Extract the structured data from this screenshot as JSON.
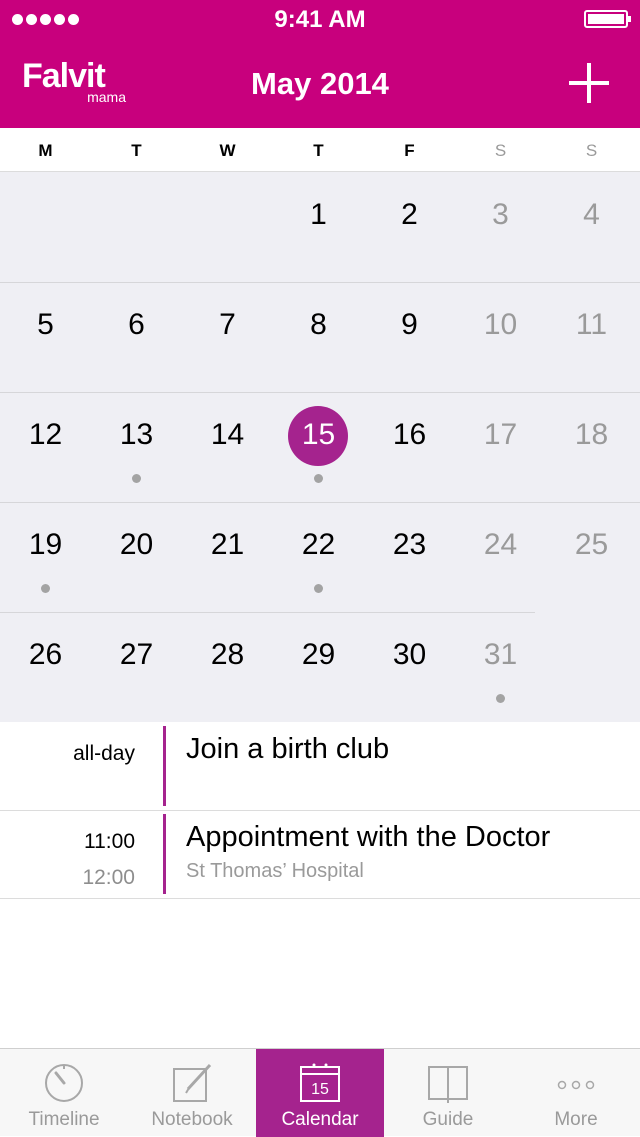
{
  "status_bar": {
    "time": "9:41 AM"
  },
  "header": {
    "logo_main": "Falvit",
    "logo_sub": "mama",
    "title": "May 2014",
    "accent": "#c8007d"
  },
  "weekdays": [
    "M",
    "T",
    "W",
    "T",
    "F",
    "S",
    "S"
  ],
  "calendar": {
    "selected_day": "15",
    "selected_color": "#a5238e",
    "weeks": [
      [
        {
          "day": "",
          "weekend": false,
          "dot": false
        },
        {
          "day": "",
          "weekend": false,
          "dot": false
        },
        {
          "day": "",
          "weekend": false,
          "dot": false
        },
        {
          "day": "1",
          "weekend": false,
          "dot": false
        },
        {
          "day": "2",
          "weekend": false,
          "dot": false
        },
        {
          "day": "3",
          "weekend": true,
          "dot": false
        },
        {
          "day": "4",
          "weekend": true,
          "dot": false
        }
      ],
      [
        {
          "day": "5",
          "weekend": false,
          "dot": false
        },
        {
          "day": "6",
          "weekend": false,
          "dot": false
        },
        {
          "day": "7",
          "weekend": false,
          "dot": false
        },
        {
          "day": "8",
          "weekend": false,
          "dot": false
        },
        {
          "day": "9",
          "weekend": false,
          "dot": false
        },
        {
          "day": "10",
          "weekend": true,
          "dot": false
        },
        {
          "day": "11",
          "weekend": true,
          "dot": false
        }
      ],
      [
        {
          "day": "12",
          "weekend": false,
          "dot": false
        },
        {
          "day": "13",
          "weekend": false,
          "dot": true
        },
        {
          "day": "14",
          "weekend": false,
          "dot": false
        },
        {
          "day": "15",
          "weekend": false,
          "dot": true,
          "selected": true
        },
        {
          "day": "16",
          "weekend": false,
          "dot": false
        },
        {
          "day": "17",
          "weekend": true,
          "dot": false
        },
        {
          "day": "18",
          "weekend": true,
          "dot": false
        }
      ],
      [
        {
          "day": "19",
          "weekend": false,
          "dot": true
        },
        {
          "day": "20",
          "weekend": false,
          "dot": false
        },
        {
          "day": "21",
          "weekend": false,
          "dot": false
        },
        {
          "day": "22",
          "weekend": false,
          "dot": true
        },
        {
          "day": "23",
          "weekend": false,
          "dot": false
        },
        {
          "day": "24",
          "weekend": true,
          "dot": false
        },
        {
          "day": "25",
          "weekend": true,
          "dot": false
        }
      ],
      [
        {
          "day": "26",
          "weekend": false,
          "dot": false
        },
        {
          "day": "27",
          "weekend": false,
          "dot": false
        },
        {
          "day": "28",
          "weekend": false,
          "dot": false
        },
        {
          "day": "29",
          "weekend": false,
          "dot": false
        },
        {
          "day": "30",
          "weekend": false,
          "dot": false
        },
        {
          "day": "31",
          "weekend": true,
          "dot": true
        },
        {
          "day": "",
          "weekend": true,
          "dot": false
        }
      ]
    ]
  },
  "events": [
    {
      "start": "all-day",
      "end": "",
      "title": "Join a birth club",
      "subtitle": ""
    },
    {
      "start": "11:00",
      "end": "12:00",
      "title": "Appointment with the Doctor",
      "subtitle": "St Thomas’ Hospital"
    }
  ],
  "tabs": [
    {
      "label": "Timeline",
      "icon": "stopwatch-icon",
      "active": false
    },
    {
      "label": "Notebook",
      "icon": "notebook-pencil-icon",
      "active": false
    },
    {
      "label": "Calendar",
      "icon": "calendar-icon",
      "active": true,
      "icon_text": "15"
    },
    {
      "label": "Guide",
      "icon": "book-icon",
      "active": false
    },
    {
      "label": "More",
      "icon": "more-dots-icon",
      "active": false
    }
  ]
}
